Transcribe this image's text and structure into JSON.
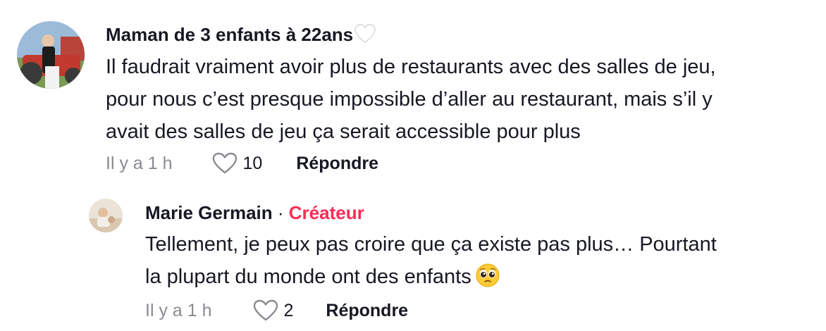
{
  "comments": [
    {
      "username": "Maman de 3 enfants à 22ans",
      "username_emoji": "🤍",
      "text_lines": [
        "Il faudrait vraiment avoir plus de restaurants avec des salles de jeu,",
        "pour nous c’est presque impossible d’aller au restaurant, mais s’il y",
        "avait des salles de jeu ça serait accessible pour plus"
      ],
      "time": "Il y a 1 h",
      "likes": "10",
      "reply_label": "Répondre"
    }
  ],
  "replies": [
    {
      "username": "Marie Germain",
      "separator": "·",
      "badge": "Créateur",
      "text_lines": [
        "Tellement, je peux pas croire que ça existe pas plus… Pourtant",
        "la plupart du monde ont des enfants"
      ],
      "text_emoji": "🥺",
      "time": "Il y a 1 h",
      "likes": "2",
      "reply_label": "Répondre"
    }
  ],
  "colors": {
    "text": "#161823",
    "muted": "#8a8b91",
    "creator": "#fe2c55"
  },
  "icons": {
    "like": "heart-outline-icon",
    "white_heart": "white-heart-icon",
    "pleading_face": "pleading-face-emoji"
  }
}
